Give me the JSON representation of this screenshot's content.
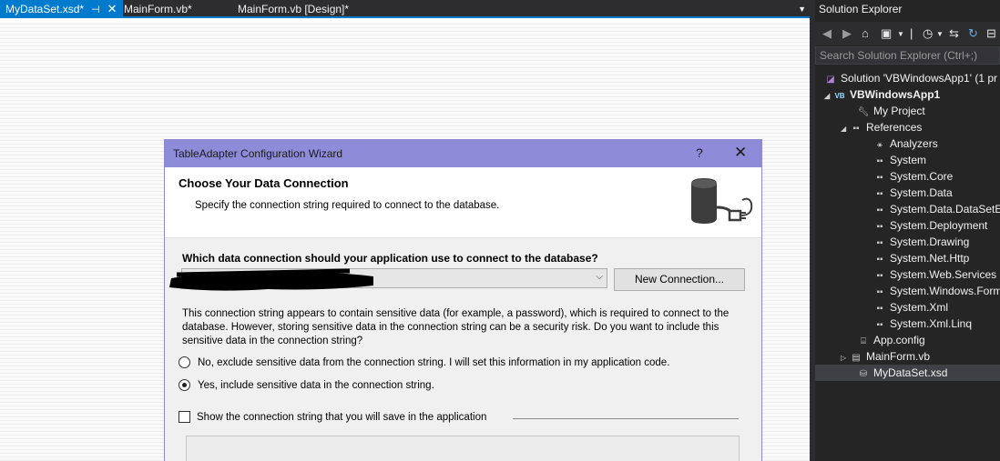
{
  "tabs": [
    {
      "label": "MyDataSet.xsd*",
      "active": true
    },
    {
      "label": "MainForm.vb*",
      "active": false
    },
    {
      "label": "MainForm.vb [Design]*",
      "active": false
    }
  ],
  "tab_overflow": "▼",
  "dialog": {
    "title": "TableAdapter Configuration Wizard",
    "help": "?",
    "close": "✕",
    "header_title": "Choose Your Data Connection",
    "header_subtitle": "Specify the connection string required to connect to the database.",
    "question": "Which data connection should your application use to connect to the database?",
    "combo_value": "",
    "new_connection_label": "New Connection...",
    "sensitive_text": "This connection string appears to contain sensitive data (for example, a password), which is required to connect to the database. However, storing sensitive data in the connection string can be a security risk. Do you want to include this sensitive data in the connection string?",
    "radio_no": "No, exclude sensitive data from the connection string. I will set this information in my application code.",
    "radio_yes": "Yes, include sensitive data in the connection string.",
    "selected_option": "yes",
    "show_string_label": "Show the connection string that you will save in the application",
    "show_string_checked": false
  },
  "solution_explorer": {
    "title": "Solution Explorer",
    "search_placeholder": "Search Solution Explorer (Ctrl+;)",
    "solution": "Solution 'VBWindowsApp1' (1 pr",
    "project": "VBWindowsApp1",
    "my_project": "My Project",
    "references": "References",
    "reference_items": [
      "Analyzers",
      "System",
      "System.Core",
      "System.Data",
      "System.Data.DataSetEx",
      "System.Deployment",
      "System.Drawing",
      "System.Net.Http",
      "System.Web.Services",
      "System.Windows.Form",
      "System.Xml",
      "System.Xml.Linq"
    ],
    "app_config": "App.config",
    "main_form": "MainForm.vb",
    "dataset": "MyDataSet.xsd"
  },
  "colors": {
    "accent": "#007acc",
    "dialog_title": "#8e8cd8",
    "panel": "#252526"
  }
}
